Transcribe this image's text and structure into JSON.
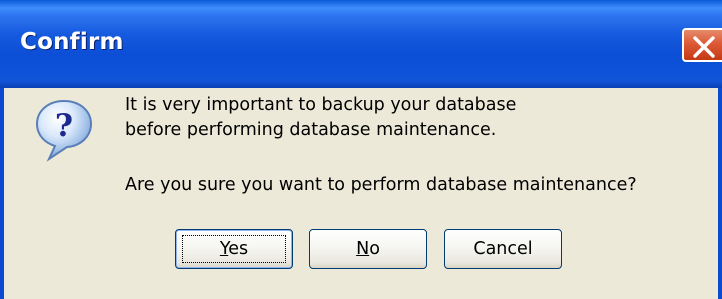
{
  "window": {
    "title": "Confirm"
  },
  "titlebar": {
    "close_icon": "close-icon"
  },
  "dialog": {
    "icon": "question-icon",
    "message_lines": [
      "It is very important to backup your database",
      "before performing database maintenance."
    ],
    "question": "Are you sure you want to perform database maintenance?"
  },
  "buttons": {
    "yes": {
      "mnemonic": "Y",
      "rest": "es"
    },
    "no": {
      "mnemonic": "N",
      "rest": "o"
    },
    "cancel": {
      "label": "Cancel"
    },
    "default": "Yes"
  },
  "colors": {
    "titlebar": "#0c4fd6",
    "face": "#ece9d8",
    "close": "#dd5a36"
  }
}
